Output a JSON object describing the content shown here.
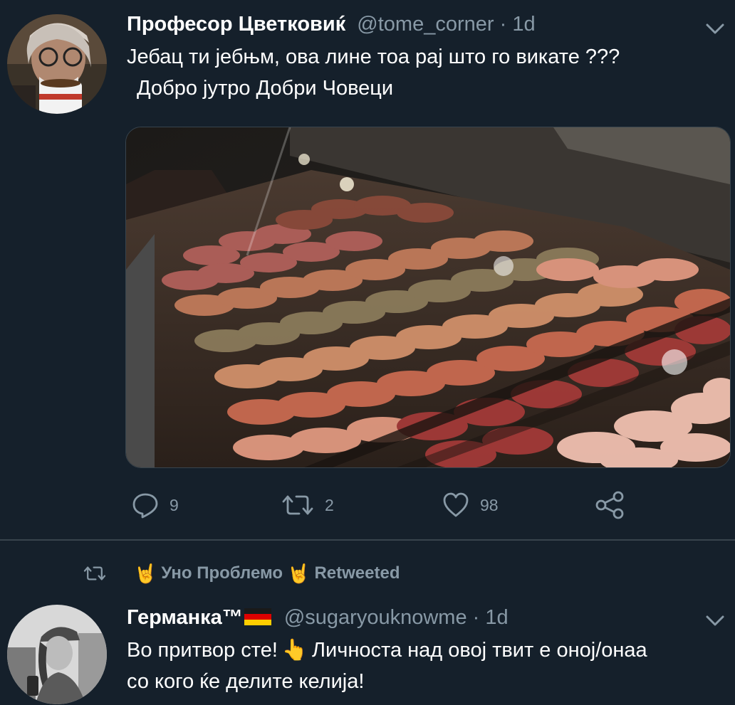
{
  "tweet1": {
    "display_name": "Професор Цветковиќ",
    "handle": "@tome_corner",
    "separator": "·",
    "time": "1d",
    "text_line1": "Јебац ти јебњм, ова лине тоа рај што го викате ???",
    "text_line2": "Добро јутро Добри Човеци",
    "actions": {
      "reply_count": "9",
      "retweet_count": "2",
      "like_count": "98"
    }
  },
  "retweet_banner": {
    "emoji_left": "🤘",
    "name": "Уно Проблемо",
    "emoji_right": "🤘",
    "label": "Retweeted"
  },
  "tweet2": {
    "display_name": "Германка™",
    "handle": "@sugaryouknowme",
    "separator": "·",
    "time": "1d",
    "text_line1_a": "Во притвор сте!",
    "text_emoji": "👆",
    "text_line1_b": "Личноста над овој твит е оној/онаа",
    "text_line2": "со кого ќе делите келија!"
  },
  "colors": {
    "background": "#15202b",
    "secondary_text": "#8899a6",
    "border": "#38444d"
  },
  "icons": [
    "chevron-down-icon",
    "reply-icon",
    "retweet-icon",
    "like-icon",
    "share-icon"
  ]
}
